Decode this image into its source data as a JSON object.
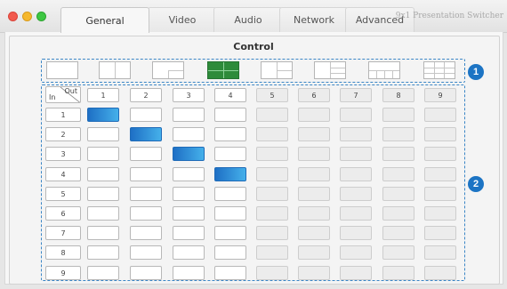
{
  "window": {
    "tabs": [
      "General",
      "Video",
      "Audio",
      "Network",
      "Advanced"
    ],
    "active_tab": "General",
    "brand": "9x1 Presentation Switcher"
  },
  "control": {
    "title": "Control",
    "layouts": [
      "full",
      "split-2",
      "pip",
      "quad",
      "1-plus-2",
      "1-plus-3",
      "1-plus-4",
      "3x3"
    ],
    "active_layout": "quad",
    "callouts": [
      "1",
      "2"
    ]
  },
  "matrix": {
    "corner_in": "In",
    "corner_out": "Out",
    "outputs": [
      "1",
      "2",
      "3",
      "4",
      "5",
      "6",
      "7",
      "8",
      "9"
    ],
    "inputs": [
      "1",
      "2",
      "3",
      "4",
      "5",
      "6",
      "7",
      "8",
      "9"
    ],
    "selected": [
      [
        1,
        1
      ],
      [
        2,
        2
      ],
      [
        3,
        3
      ],
      [
        4,
        4
      ]
    ],
    "disabled_outputs": [
      "5",
      "6",
      "7",
      "8",
      "9"
    ]
  },
  "colors": {
    "accent": "#1c74c4",
    "active_layout": "#2e8b3a",
    "selected_cell": "#2a8ddd"
  }
}
